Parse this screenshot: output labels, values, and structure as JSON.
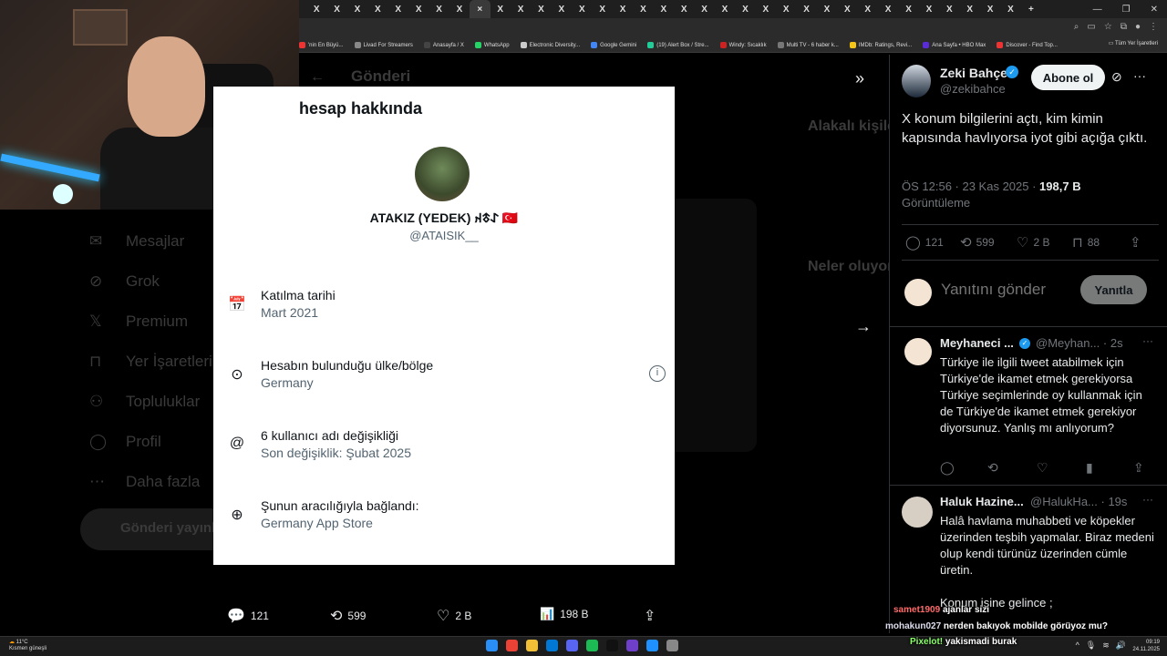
{
  "browser": {
    "tabs": [
      "X",
      "X",
      "X",
      "X",
      "X",
      "X",
      "X",
      "X",
      "×",
      "X",
      "X",
      "X",
      "X",
      "X",
      "X",
      "X",
      "X",
      "X",
      "X",
      "X",
      "X",
      "X",
      "X",
      "X",
      "X",
      "X",
      "X",
      "X",
      "X",
      "X",
      "X",
      "X",
      "X",
      "X",
      "X",
      "+"
    ],
    "window_controls": [
      "—",
      "⌃",
      "❐",
      "✕"
    ],
    "bookmarks": [
      {
        "label": "'nin En Büyü...",
        "color": "#e33"
      },
      {
        "label": "Livad For Streamers",
        "color": "#888"
      },
      {
        "label": "Anasayfa / X",
        "color": "#444"
      },
      {
        "label": "WhatsApp",
        "color": "#25d366"
      },
      {
        "label": "Electronic Diversity...",
        "color": "#ccc"
      },
      {
        "label": "Google Gemini",
        "color": "#4285f4"
      },
      {
        "label": "(19) Alert Box / Stre...",
        "color": "#2c9"
      },
      {
        "label": "Windy: Sıcaklık",
        "color": "#c22"
      },
      {
        "label": "Multi TV - 6 haber k...",
        "color": "#777"
      },
      {
        "label": "IMDb: Ratings, Revi...",
        "color": "#f5c518"
      },
      {
        "label": "Ana Sayfa • HBO Max",
        "color": "#5b2bd8"
      },
      {
        "label": "Discover - Find Top...",
        "color": "#e33"
      }
    ],
    "bookmarks_right": "Tüm Yer İşaretleri"
  },
  "background_page": {
    "header": "Gönderi",
    "nav": [
      "Mesajlar",
      "Grok",
      "Premium",
      "Yer İşaretleri",
      "Topluluklar",
      "Profil",
      "Daha fazla"
    ],
    "post_button": "Gönderi yayınla",
    "relevant": "Alakalı kişiler",
    "whats_happening": "Neler oluyor"
  },
  "overlay": {
    "title": "hesap hakkında",
    "name": "ATAKIZ (YEDEK) 𐰀𐱃𐰴 🇹🇷",
    "handle": "@ATAISIK__",
    "rows": [
      {
        "icon": "calendar-icon",
        "glyph": "📅",
        "label": "Katılma tarihi",
        "value": "Mart 2021"
      },
      {
        "icon": "location-icon",
        "glyph": "⊙",
        "label": "Hesabın bulunduğu ülke/bölge",
        "value": "Germany"
      },
      {
        "icon": "at-icon",
        "glyph": "@",
        "label": "6 kullanıcı adı değişikliği",
        "value": "Son değişiklik: Şubat 2025"
      },
      {
        "icon": "globe-icon",
        "glyph": "⊕",
        "label": "Şunun aracılığıyla bağlandı:",
        "value": "Germany App Store"
      }
    ],
    "info_glyph": "i"
  },
  "stats": {
    "replies": "121",
    "reposts": "599",
    "likes": "2 B",
    "views": "198 B"
  },
  "tweet": {
    "author": "Zeki Bahçe",
    "handle": "@zekibahce",
    "follow_label": "Abone ol",
    "text": "X konum bilgilerini açtı, kim kimin kapısında havlıyorsa iyot gibi açığa çıktı.",
    "time": "ÖS 12:56 · 23 Kas 2025 · ",
    "views": "198,7 B",
    "views_label": "Görüntüleme",
    "replies": "121",
    "reposts": "599",
    "likes": "2 B",
    "bookmarks": "88",
    "reply_placeholder": "Yanıtını gönder",
    "reply_button": "Yanıtla"
  },
  "replies": [
    {
      "name": "Meyhaneci ...",
      "handle": "@Meyhan...",
      "time": "· 2s",
      "text": "Türkiye ile ilgili tweet atabilmek için Türkiye'de ikamet etmek gerekiyorsa Türkiye seçimlerinde oy kullanmak için de Türkiye'de ikamet etmek gerekiyor diyorsunuz. Yanlış mı anlıyorum?"
    },
    {
      "name": "Haluk Hazine...",
      "handle": "@HalukHa...",
      "time": "· 19s",
      "text": "Halâ havlama muhabbeti ve köpekler üzerinden teşbih yapmalar. Biraz medeni olup kendi türünüz üzerinden cümle üretin.",
      "text2": "Konum işine gelince ;"
    }
  ],
  "chat": [
    {
      "user": "samet1909",
      "msg": "ajanlar sizi",
      "user_color": "#ff5a5a"
    },
    {
      "user": "mohakun027",
      "msg": "nerden bakıyok mobilde görüyoz mu?",
      "user_color": "#e0e0ff"
    },
    {
      "user": "Pixelot!",
      "msg": "yakismadi burak",
      "user_color": "#7dff6a"
    }
  ],
  "taskbar": {
    "weather_temp": "11°C",
    "weather_desc": "Kısmen güneşli",
    "time": "09:19",
    "date": "24.11.2025",
    "app_colors": [
      "#2a8ef7",
      "#ea4335",
      "#f2c037",
      "#0078d4",
      "#5865f2",
      "#1db954",
      "#111",
      "#6e40c9",
      "#1e90ff",
      "#888"
    ]
  },
  "icons": {
    "reply": "💬",
    "repost": "⟲",
    "like": "♡",
    "views": "📊",
    "share": "⇪",
    "bookmark": "🔖",
    "collapse": "»",
    "next": "→",
    "more": "···",
    "grok": "⊘"
  }
}
